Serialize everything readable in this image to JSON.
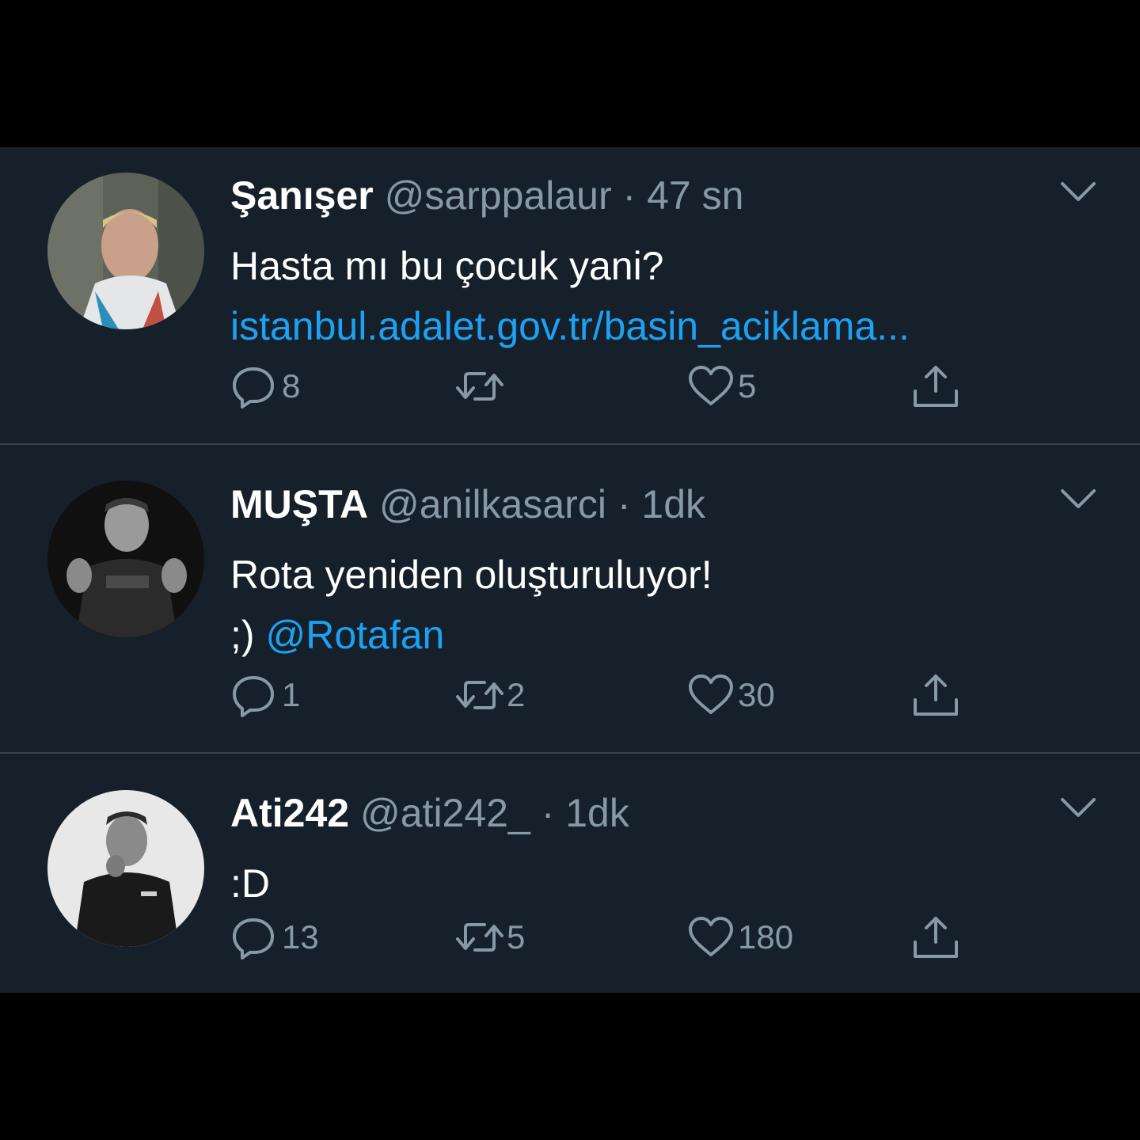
{
  "colors": {
    "background": "#15202b",
    "page": "#000000",
    "text": "#ffffff",
    "secondary": "#8899a6",
    "link": "#1da1f2",
    "divider": "#38444d"
  },
  "tweets": [
    {
      "name": "Şanışer",
      "handle": "@sarppalaur",
      "separator": "·",
      "time": "47 sn",
      "text": "Hasta mı bu çocuk yani?",
      "link": "istanbul.adalet.gov.tr/basin_aciklama...",
      "replies": "8",
      "retweets": "",
      "likes": "5",
      "icons": [
        "reply-icon",
        "retweet-icon",
        "like-icon",
        "share-icon",
        "chevron-down-icon"
      ]
    },
    {
      "name": "MUŞTA",
      "handle": "@anilkasarci",
      "separator": "·",
      "time": "1dk",
      "text": "Rota yeniden oluşturuluyor!",
      "text2": ";)",
      "mention": "@Rotafan",
      "replies": "1",
      "retweets": "2",
      "likes": "30"
    },
    {
      "name": "Ati242",
      "handle": "@ati242_",
      "separator": "·",
      "time": "1dk",
      "text": ":D",
      "replies": "13",
      "retweets": "5",
      "likes": "180"
    }
  ]
}
